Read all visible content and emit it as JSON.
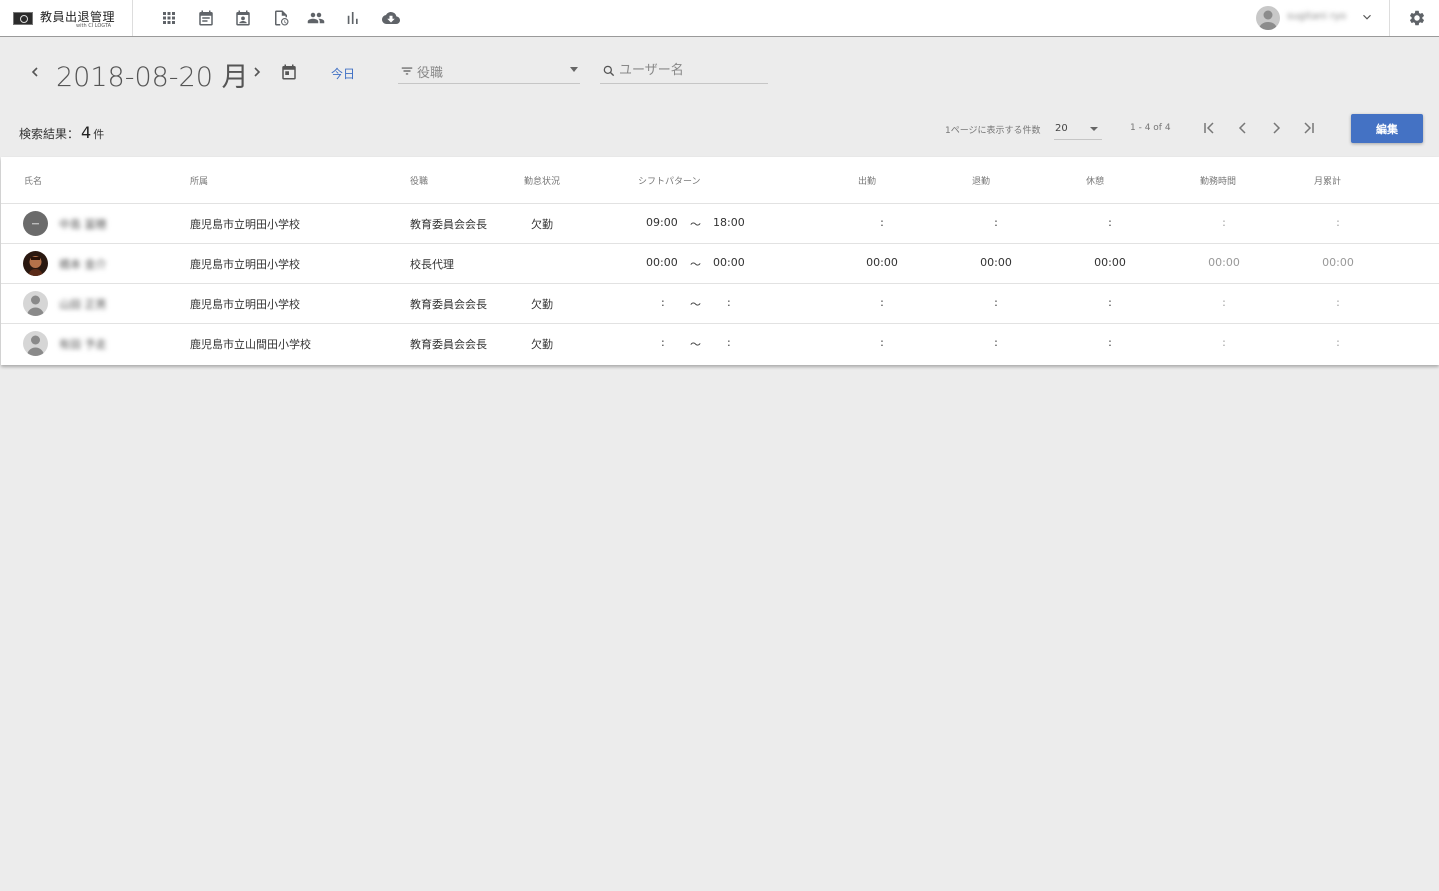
{
  "app": {
    "title": "教員出退管理",
    "subtitle": "with CI LOGTA"
  },
  "header": {
    "icons": [
      "apps-icon",
      "daily-icon",
      "calendar-user-icon",
      "report-icon",
      "users-icon",
      "chart-icon",
      "cloud-download-icon"
    ],
    "user_name": "sugitani ryo"
  },
  "toolbar": {
    "date": "2018-08-20 月",
    "today_label": "今日",
    "role_placeholder": "役職",
    "search_placeholder": "ユーザー名"
  },
  "results": {
    "label": "検索結果：",
    "count": "4",
    "unit": "件",
    "per_page_label": "1ページに表示する件数",
    "per_page_value": "20",
    "range": "1 - 4 of 4",
    "edit_label": "編集"
  },
  "table": {
    "columns": [
      "氏名",
      "所属",
      "役職",
      "勤怠状況",
      "シフトパターン",
      "出勤",
      "退勤",
      "休憩",
      "勤務時間",
      "月累計"
    ],
    "rows": [
      {
        "avatar": "dark-circle",
        "name": "中島 冨穂",
        "affiliation": "鹿児島市立明田小学校",
        "position": "教育委員会会長",
        "status": "欠勤",
        "shift_start": "09:00",
        "tilde": "～",
        "shift_end": "18:00",
        "clock_in": ":",
        "clock_out": ":",
        "break": ":",
        "work_time": ":",
        "monthly": ":"
      },
      {
        "avatar": "photo",
        "name": "橋本 金介",
        "affiliation": "鹿児島市立明田小学校",
        "position": "校長代理",
        "status": "",
        "shift_start": "00:00",
        "tilde": "～",
        "shift_end": "00:00",
        "clock_in": "00:00",
        "clock_out": "00:00",
        "break": "00:00",
        "work_time": "00:00",
        "monthly": "00:00"
      },
      {
        "avatar": "person",
        "name": "山田 正男",
        "affiliation": "鹿児島市立明田小学校",
        "position": "教育委員会会長",
        "status": "欠勤",
        "shift_start": ":",
        "tilde": "～",
        "shift_end": ":",
        "clock_in": ":",
        "clock_out": ":",
        "break": ":",
        "work_time": ":",
        "monthly": ":"
      },
      {
        "avatar": "person",
        "name": "有田 予走",
        "affiliation": "鹿児島市立山間田小学校",
        "position": "教育委員会会長",
        "status": "欠勤",
        "shift_start": ":",
        "tilde": "～",
        "shift_end": ":",
        "clock_in": ":",
        "clock_out": ":",
        "break": ":",
        "work_time": ":",
        "monthly": ":"
      }
    ]
  },
  "colors": {
    "accent": "#4472c4",
    "link": "#3f6fc4",
    "background": "#ececec"
  }
}
